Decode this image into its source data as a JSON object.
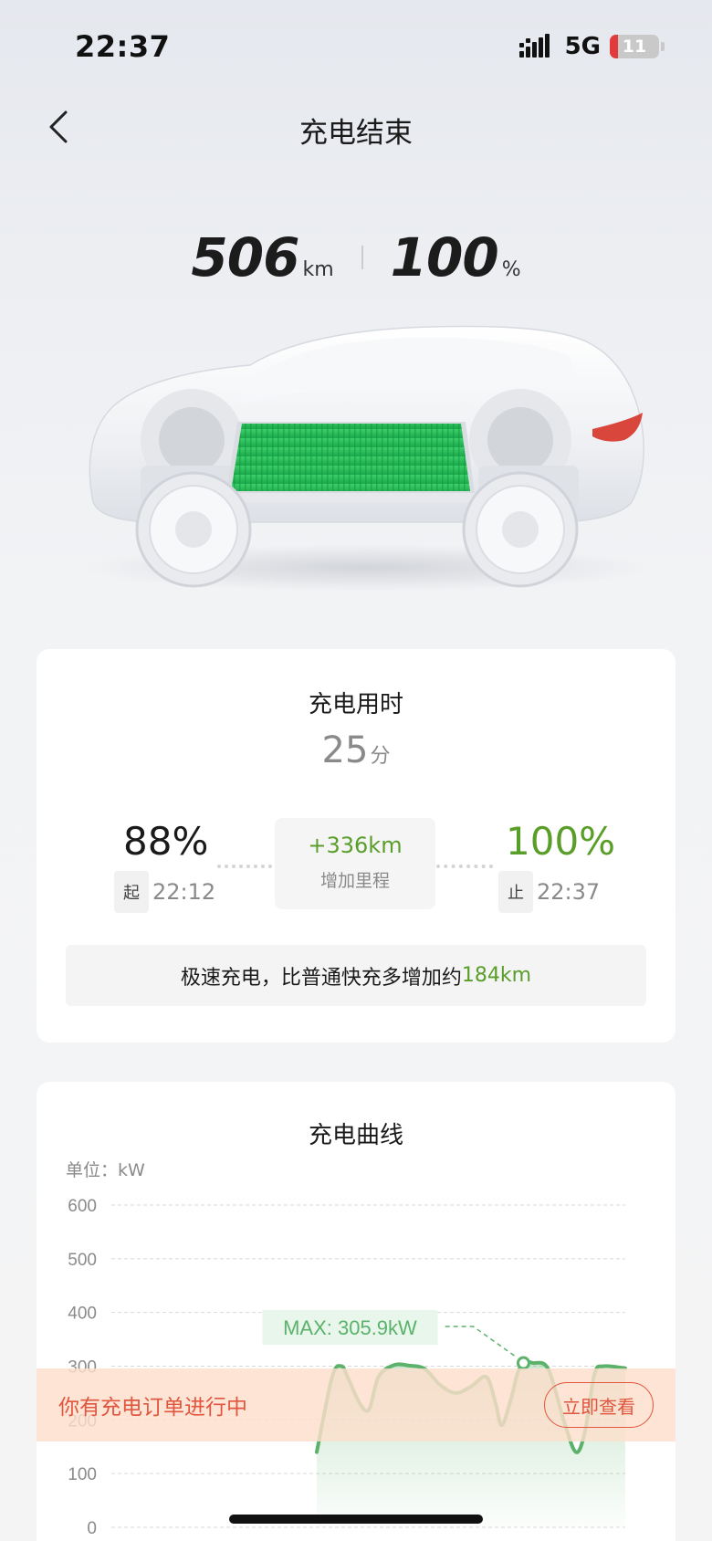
{
  "status_bar": {
    "time": "22:37",
    "network": "5G",
    "battery": "11"
  },
  "header": {
    "title": "充电结束"
  },
  "summary": {
    "range_value": "506",
    "range_unit": "km",
    "soc_value": "100",
    "soc_unit": "%"
  },
  "charge_time_card": {
    "title": "充电用时",
    "duration_value": "25",
    "duration_unit": "分",
    "start": {
      "soc": "88%",
      "tag": "起",
      "time": "22:12"
    },
    "end": {
      "soc": "100%",
      "tag": "止",
      "time": "22:37"
    },
    "added_range": {
      "value": "+336km",
      "label": "增加里程"
    },
    "tip": {
      "text": "极速充电，比普通快充多增加约",
      "highlight": "184km"
    }
  },
  "curve_card": {
    "title": "充电曲线",
    "unit_label": "单位：kW",
    "max_label": "MAX: 305.9kW"
  },
  "chart_data": {
    "type": "area",
    "title": "充电曲线",
    "ylabel": "单位：kW",
    "ylim": [
      0,
      600
    ],
    "yticks": [
      0,
      100,
      200,
      300,
      400,
      500,
      600
    ],
    "grid": true,
    "x_progress": [
      0,
      0.05,
      0.08,
      0.1,
      0.14,
      0.17,
      0.2,
      0.25,
      0.3,
      0.35,
      0.4,
      0.45,
      0.5,
      0.55,
      0.58,
      0.6,
      0.63,
      0.65,
      0.67,
      0.7,
      0.75,
      0.8,
      0.84,
      0.87,
      0.9,
      0.93,
      1.0
    ],
    "values": [
      140,
      280,
      300,
      280,
      230,
      220,
      280,
      302,
      301,
      295,
      265,
      250,
      262,
      280,
      230,
      190,
      240,
      285,
      305.9,
      306,
      295,
      200,
      140,
      180,
      285,
      300,
      296
    ],
    "max": {
      "value": 305.9,
      "label": "MAX: 305.9kW"
    },
    "colors": {
      "line": "#5cb26a",
      "fill": "#5cb26a"
    }
  },
  "banner": {
    "text": "你有充电订单进行中",
    "button": "立即查看",
    "color": "#e0563f"
  }
}
